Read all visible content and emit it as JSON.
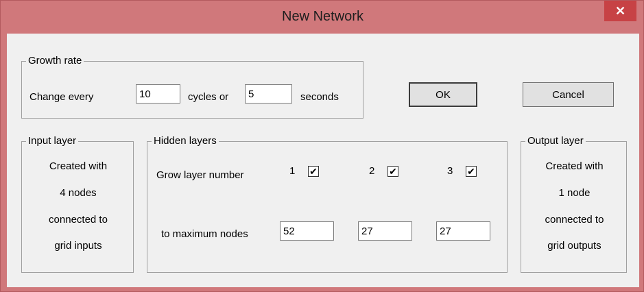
{
  "window": {
    "title": "New Network",
    "close_symbol": "✕"
  },
  "growth": {
    "legend": "Growth rate",
    "change_every": "Change every",
    "cycles_value": "10",
    "cycles_or": "cycles or",
    "seconds_value": "5",
    "seconds": "seconds"
  },
  "buttons": {
    "ok": "OK",
    "cancel": "Cancel"
  },
  "input_layer": {
    "legend": "Input layer",
    "lines": [
      "Created with",
      "4 nodes",
      "connected to",
      "grid inputs"
    ]
  },
  "hidden": {
    "legend": "Hidden layers",
    "grow_label": "Grow layer number",
    "max_label": "to maximum nodes",
    "layers": [
      {
        "number": "1",
        "checked": true,
        "max": "52"
      },
      {
        "number": "2",
        "checked": true,
        "max": "27"
      },
      {
        "number": "3",
        "checked": true,
        "max": "27"
      }
    ]
  },
  "output_layer": {
    "legend": "Output layer",
    "lines": [
      "Created with",
      "1 node",
      "connected to",
      "grid outputs"
    ]
  },
  "check_glyph": "✔"
}
